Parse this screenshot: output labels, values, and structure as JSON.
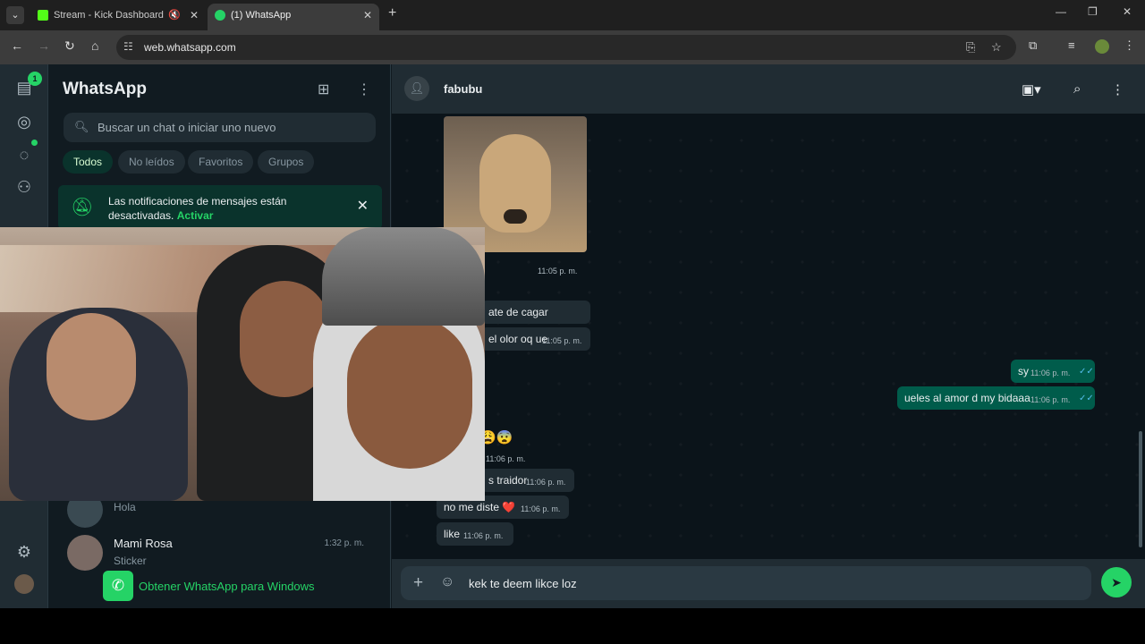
{
  "browser": {
    "tabs": [
      {
        "title": "Stream - Kick Dashboard",
        "favicon_color": "#53fc18"
      },
      {
        "title": "(1) WhatsApp",
        "favicon_color": "#25d366"
      }
    ],
    "url": "web.whatsapp.com"
  },
  "rail": {
    "unread_badge": "1"
  },
  "sidebar": {
    "title": "WhatsApp",
    "search_placeholder": "Buscar un chat o iniciar uno nuevo",
    "filters": [
      "Todos",
      "No leídos",
      "Favoritos",
      "Grupos"
    ],
    "notice": {
      "text": "Las notificaciones de mensajes están desactivadas.",
      "link": "Activar"
    },
    "chats": [
      {
        "name": "",
        "preview": "Hola",
        "time": ""
      },
      {
        "name": "Mami Rosa",
        "preview": "Sticker",
        "time": "1:32 p. m."
      }
    ],
    "get_windows": "Obtener WhatsApp para Windows"
  },
  "chat": {
    "contact": "fabubu",
    "photo_time": "11:05 p. m.",
    "messages": [
      {
        "dir": "in",
        "text": "ate de cagar",
        "time": ""
      },
      {
        "dir": "in",
        "text": "el olor oq ue",
        "time": "11:05 p. m."
      },
      {
        "dir": "out",
        "text": "sy",
        "time": "11:06 p. m."
      },
      {
        "dir": "out",
        "text": "ueles al amor d my bidaaa",
        "time": "11:06 p. m."
      },
      {
        "dir": "in",
        "text": "s traidor",
        "time": "11:06 p. m."
      },
      {
        "dir": "in",
        "text": "no me diste ❤️",
        "time": "11:06 p. m."
      },
      {
        "dir": "in",
        "text": "like",
        "time": "11:06 p. m."
      }
    ],
    "emoji_message": "😩😨",
    "emoji_time": "11:06 p. m.",
    "composer_text": "kek te deem likce loz"
  },
  "colors": {
    "accent": "#25d366",
    "bubble_out": "#005c4b",
    "bubble_in": "#202c33",
    "bg": "#111b21"
  }
}
